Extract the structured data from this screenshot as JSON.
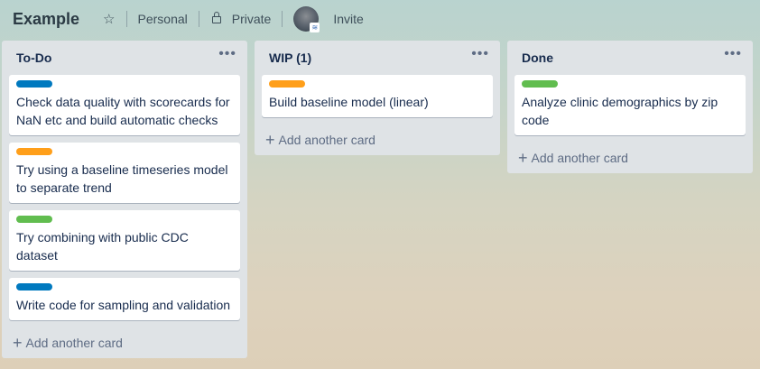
{
  "header": {
    "board_title": "Example",
    "visibility_team": "Personal",
    "visibility_privacy": "Private",
    "invite_label": "Invite",
    "star_icon": "☆",
    "avatar_badge": "≋"
  },
  "lists": [
    {
      "title": "To-Do",
      "menu": "•••",
      "add_label": "Add another card",
      "cards": [
        {
          "label_color": "#0079bf",
          "text": "Check data quality with scorecards for NaN etc and build automatic checks"
        },
        {
          "label_color": "#ff9f1a",
          "text": "Try using a baseline timeseries model to separate trend"
        },
        {
          "label_color": "#61bd4f",
          "text": "Try combining with public CDC dataset"
        },
        {
          "label_color": "#0079bf",
          "text": "Write code for sampling and validation"
        }
      ]
    },
    {
      "title": "WIP (1)",
      "menu": "•••",
      "add_label": "Add another card",
      "cards": [
        {
          "label_color": "#ff9f1a",
          "text": "Build baseline model (linear)"
        }
      ]
    },
    {
      "title": "Done",
      "menu": "•••",
      "add_label": "Add another card",
      "cards": [
        {
          "label_color": "#61bd4f",
          "text": "Analyze clinic demographics by zip code"
        }
      ]
    }
  ],
  "plus_symbol": "+"
}
